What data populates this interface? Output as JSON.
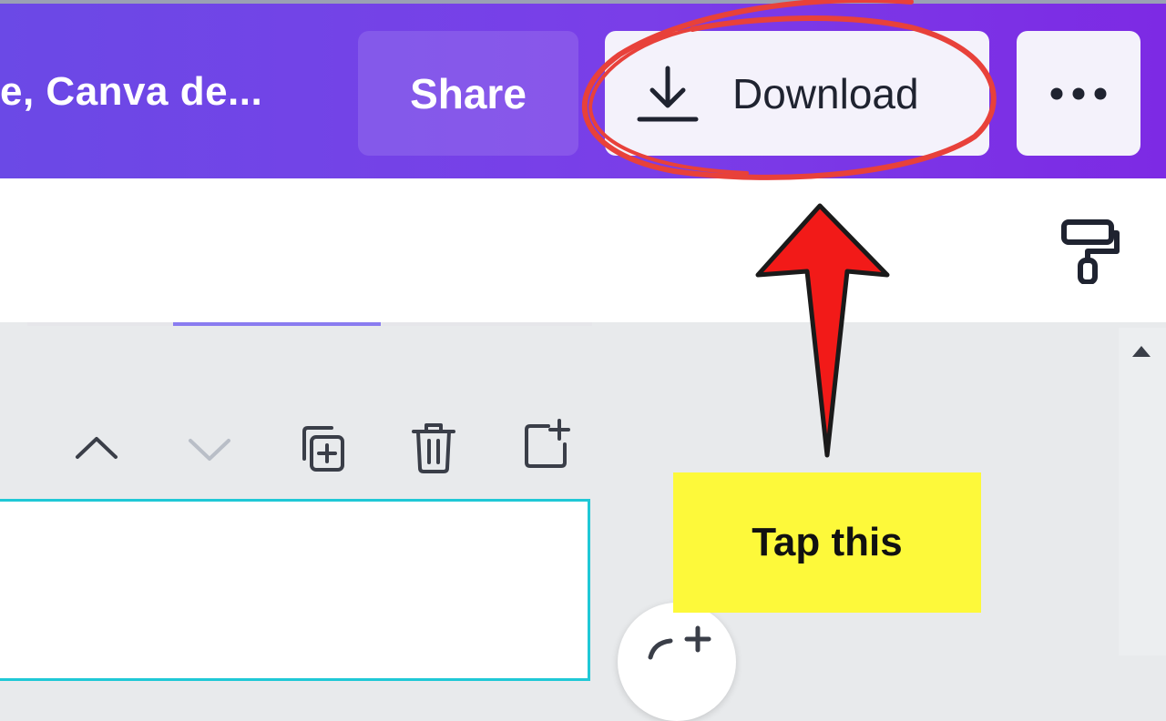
{
  "header": {
    "title": "e, Canva de...",
    "share_label": "Share",
    "download_label": "Download",
    "more_label": "•••"
  },
  "toolbar": {
    "tool_icon": "paint-roller-icon"
  },
  "page_controls": {
    "icons": [
      "chevron-up-icon",
      "chevron-down-icon",
      "duplicate-page-icon",
      "trash-icon",
      "add-page-icon"
    ]
  },
  "annotation": {
    "callout_text": "Tap this",
    "circle_color": "#e8413a",
    "arrow_color": "#f01414",
    "callout_bg": "#fdf93a"
  },
  "colors": {
    "header_start": "#6b49e6",
    "header_end": "#7d2ae4",
    "selection_outline": "#1fc8d6"
  }
}
